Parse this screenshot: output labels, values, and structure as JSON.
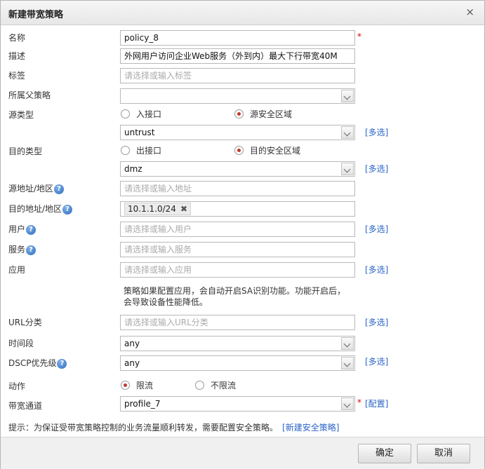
{
  "dialog": {
    "title": "新建带宽策略",
    "close_symbol": "×"
  },
  "labels": {
    "name": "名称",
    "description": "描述",
    "tags": "标签",
    "parent_policy": "所属父策略",
    "source_type": "源类型",
    "dest_type": "目的类型",
    "source_address": "源地址/地区",
    "dest_address": "目的地址/地区",
    "user": "用户",
    "service": "服务",
    "application": "应用",
    "url_category": "URL分类",
    "time_range": "时间段",
    "dscp_priority": "DSCP优先级",
    "action": "动作",
    "bandwidth_channel": "带宽通道"
  },
  "fields": {
    "name_value": "policy_8",
    "description_value": "外网用户访问企业Web服务（外到内）最大下行带宽40M",
    "tags_placeholder": "请选择或输入标签",
    "parent_policy_value": "",
    "source_zone_value": "untrust",
    "dest_zone_value": "dmz",
    "source_address_placeholder": "请选择或输入地址",
    "dest_address_tag": "10.1.1.0/24",
    "user_placeholder": "请选择或输入用户",
    "service_placeholder": "请选择或输入服务",
    "application_placeholder": "请选择或输入应用",
    "url_category_placeholder": "请选择或输入URL分类",
    "time_range_value": "any",
    "dscp_value": "any",
    "bandwidth_channel_value": "profile_7"
  },
  "radios": {
    "source_interface": "入接口",
    "source_zone": "源安全区域",
    "dest_interface": "出接口",
    "dest_zone": "目的安全区域",
    "action_limit": "限流",
    "action_no_limit": "不限流"
  },
  "links": {
    "multi_select": "[多选]",
    "configure": "[配置]",
    "new_security_policy": "[新建安全策略]"
  },
  "help_symbol": "?",
  "tag_remove_symbol": "✖",
  "required_mark": "*",
  "application_note": "策略如果配置应用，会自动开启SA识别功能。功能开启后，会导致设备性能降低。",
  "tip": "提示：为保证受带宽策略控制的业务流量顺利转发，需要配置安全策略。",
  "buttons": {
    "ok": "确定",
    "cancel": "取消"
  },
  "colors": {
    "accent_radio": "#c0392b",
    "link": "#2a64c6",
    "required": "#dd0000"
  }
}
